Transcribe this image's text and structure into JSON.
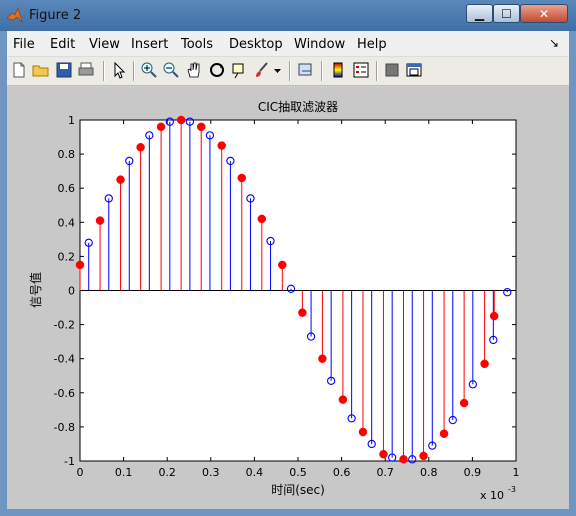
{
  "window": {
    "title": "Figure 2",
    "close_glyph": "✕",
    "min_glyph": "▁",
    "max_glyph": "☐"
  },
  "menu": [
    "File",
    "Edit",
    "View",
    "Insert",
    "Tools",
    "Desktop",
    "Window",
    "Help"
  ],
  "toolbar_icons": [
    "new-figure-icon",
    "open-file-icon",
    "save-icon",
    "print-icon",
    "pointer-icon",
    "zoom-in-icon",
    "zoom-out-icon",
    "pan-hand-icon",
    "rotate-3d-icon",
    "data-cursor-icon",
    "brush-icon",
    "brush-dropdown-icon",
    "link-plot-icon",
    "colorbar-icon",
    "legend-icon",
    "hide-plot-tools-icon",
    "show-plot-tools-icon"
  ],
  "chart_data": {
    "type": "stem",
    "title": "CIC抽取滤波器",
    "xlabel": "时间(sec)",
    "ylabel": "信号值",
    "x_exponent_label": "x 10",
    "x_exponent": "-3",
    "xlim": [
      0,
      1.0
    ],
    "ylim": [
      -1,
      1
    ],
    "xticks": [
      "0",
      "0.1",
      "0.2",
      "0.3",
      "0.4",
      "0.5",
      "0.6",
      "0.7",
      "0.8",
      "0.9",
      "1"
    ],
    "yticks": [
      "1",
      "0.8",
      "0.6",
      "0.4",
      "0.2",
      "0",
      "-0.2",
      "-0.4",
      "-0.6",
      "-0.8",
      "-1"
    ],
    "grid": false,
    "series": [
      {
        "color": "#0000ff",
        "marker": "open-circle",
        "x": [
          0.02,
          0.066,
          0.113,
          0.159,
          0.206,
          0.252,
          0.298,
          0.345,
          0.391,
          0.437,
          0.484,
          0.53,
          0.576,
          0.623,
          0.669,
          0.716,
          0.762,
          0.808,
          0.855,
          0.901,
          0.948,
          0.98
        ],
        "y": [
          0.28,
          0.54,
          0.76,
          0.91,
          0.99,
          0.99,
          0.91,
          0.76,
          0.54,
          0.29,
          0.01,
          -0.27,
          -0.53,
          -0.75,
          -0.9,
          -0.98,
          -0.99,
          -0.91,
          -0.76,
          -0.55,
          -0.29,
          -0.01
        ]
      },
      {
        "color": "#ff0000",
        "marker": "filled-circle",
        "x": [
          0.0,
          0.046,
          0.093,
          0.139,
          0.186,
          0.232,
          0.278,
          0.325,
          0.371,
          0.417,
          0.464,
          0.51,
          0.556,
          0.603,
          0.649,
          0.696,
          0.742,
          0.788,
          0.835,
          0.881,
          0.928,
          0.95
        ],
        "y": [
          0.15,
          0.41,
          0.65,
          0.84,
          0.96,
          1.0,
          0.96,
          0.85,
          0.66,
          0.42,
          0.15,
          -0.13,
          -0.4,
          -0.64,
          -0.83,
          -0.96,
          -0.99,
          -0.97,
          -0.84,
          -0.66,
          -0.43,
          -0.15
        ]
      }
    ]
  }
}
